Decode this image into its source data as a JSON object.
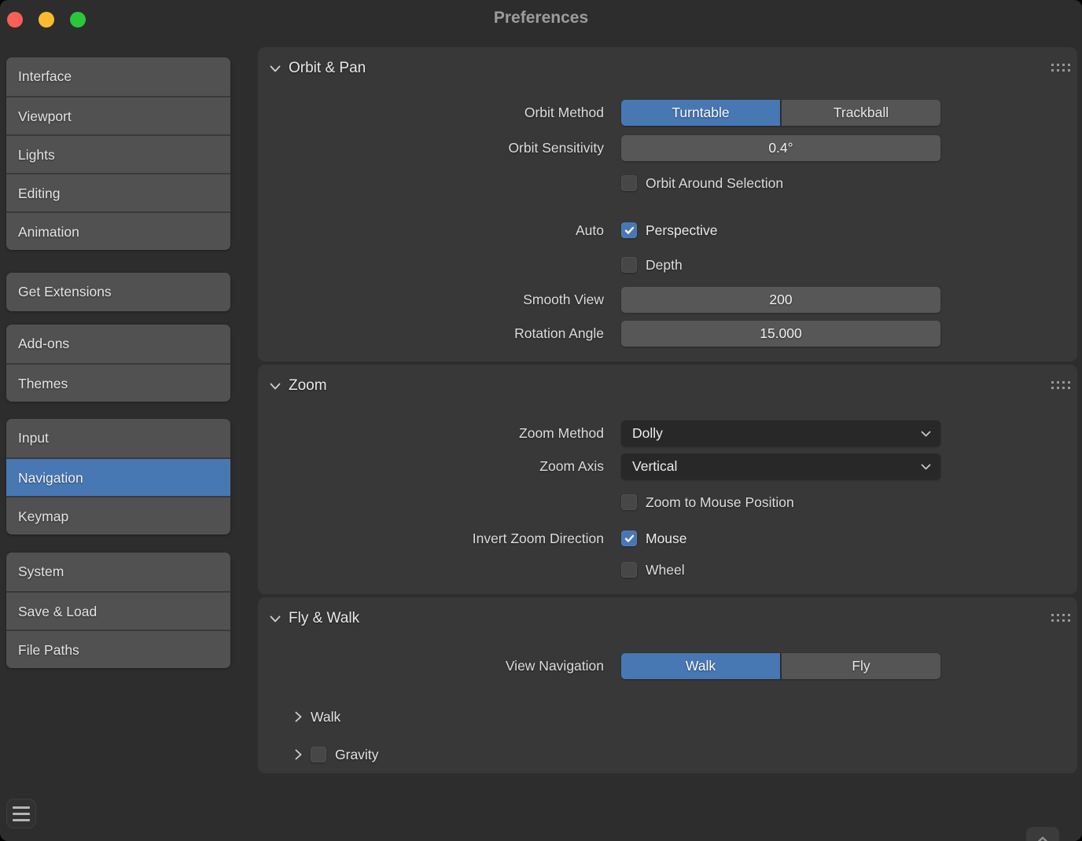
{
  "window": {
    "title": "Preferences"
  },
  "titlebar_buttons": {
    "close": "close-button",
    "minimize": "minimize-button",
    "zoom": "zoom-button"
  },
  "colors": {
    "accent_blue": "#4878b4",
    "window_bg": "#2d2d2d",
    "panel_bg": "#383838",
    "sidebar_item_bg": "#515151",
    "field_bg": "#575757",
    "dropdown_bg": "#282828",
    "traffic_close": "#f75f57",
    "traffic_minimize": "#f9bc2e",
    "traffic_zoom": "#2cc63e"
  },
  "sidebar": {
    "groups": [
      {
        "items": [
          {
            "label": "Interface",
            "active": false
          },
          {
            "label": "Viewport",
            "active": false
          },
          {
            "label": "Lights",
            "active": false
          },
          {
            "label": "Editing",
            "active": false
          },
          {
            "label": "Animation",
            "active": false
          }
        ]
      },
      {
        "items": [
          {
            "label": "Get Extensions",
            "active": false
          }
        ]
      },
      {
        "items": [
          {
            "label": "Add-ons",
            "active": false
          },
          {
            "label": "Themes",
            "active": false
          }
        ]
      },
      {
        "items": [
          {
            "label": "Input",
            "active": false
          },
          {
            "label": "Navigation",
            "active": true
          },
          {
            "label": "Keymap",
            "active": false
          }
        ]
      },
      {
        "items": [
          {
            "label": "System",
            "active": false
          },
          {
            "label": "Save & Load",
            "active": false
          },
          {
            "label": "File Paths",
            "active": false
          }
        ]
      }
    ]
  },
  "orbit_pan": {
    "title": "Orbit & Pan",
    "orbit_method": {
      "label": "Orbit Method",
      "options": [
        "Turntable",
        "Trackball"
      ],
      "selected": "Turntable"
    },
    "orbit_sensitivity": {
      "label": "Orbit Sensitivity",
      "value": "0.4°"
    },
    "orbit_around_selection": {
      "label": "Orbit Around Selection",
      "checked": false
    },
    "auto": {
      "label": "Auto",
      "perspective": {
        "label": "Perspective",
        "checked": true
      },
      "depth": {
        "label": "Depth",
        "checked": false
      }
    },
    "smooth_view": {
      "label": "Smooth View",
      "value": "200"
    },
    "rotation_angle": {
      "label": "Rotation Angle",
      "value": "15.000"
    }
  },
  "zoom": {
    "title": "Zoom",
    "zoom_method": {
      "label": "Zoom Method",
      "value": "Dolly"
    },
    "zoom_axis": {
      "label": "Zoom Axis",
      "value": "Vertical"
    },
    "zoom_to_mouse": {
      "label": "Zoom to Mouse Position",
      "checked": false
    },
    "invert_zoom_direction": {
      "label": "Invert Zoom Direction",
      "mouse": {
        "label": "Mouse",
        "checked": true
      },
      "wheel": {
        "label": "Wheel",
        "checked": false
      }
    }
  },
  "fly_walk": {
    "title": "Fly & Walk",
    "view_navigation": {
      "label": "View Navigation",
      "options": [
        "Walk",
        "Fly"
      ],
      "selected": "Walk"
    },
    "walk_subpanel": {
      "label": "Walk",
      "collapsed": true
    },
    "gravity_subpanel": {
      "label": "Gravity",
      "collapsed": true,
      "checked": false
    }
  },
  "icons": {
    "section_collapse": "chevron-down",
    "subpanel_collapsed": "chevron-right",
    "dropdown_arrow": "chevron-down",
    "panel_grip": "drag-dots",
    "footer_menu": "hamburger-menu",
    "scroll_hint": "chevron-up"
  }
}
